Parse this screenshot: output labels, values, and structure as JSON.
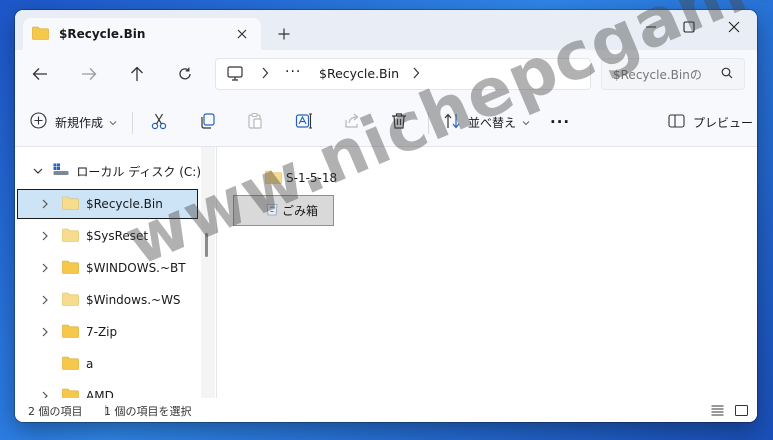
{
  "tab": {
    "title": "$Recycle.Bin",
    "close_icon": "close-icon",
    "new_tab_icon": "plus-icon"
  },
  "window_controls": {
    "minimize_icon": "minimize-icon",
    "maximize_icon": "maximize-icon",
    "close_icon": "close-icon"
  },
  "nav": {
    "back_icon": "arrow-left-icon",
    "forward_icon": "arrow-right-icon",
    "up_icon": "arrow-up-icon",
    "refresh_icon": "refresh-icon",
    "address": {
      "pc_icon": "monitor-icon",
      "more": "···",
      "crumb": "$Recycle.Bin"
    },
    "search": {
      "placeholder": "$Recycle.Binの",
      "icon": "search-icon"
    }
  },
  "commands": {
    "new_label": "新規作成",
    "sort_label": "並べ替え",
    "more_label": "···",
    "preview_label": "プレビュー"
  },
  "sidebar": {
    "drive": "ローカル ディスク (C:)",
    "items": [
      {
        "label": "$Recycle.Bin",
        "selected": true,
        "expandable": true
      },
      {
        "label": "$SysReset",
        "expandable": true
      },
      {
        "label": "$WINDOWS.~BT",
        "expandable": true
      },
      {
        "label": "$Windows.~WS",
        "expandable": true
      },
      {
        "label": "7-Zip",
        "expandable": true
      },
      {
        "label": "a",
        "expandable": false
      },
      {
        "label": "AMD",
        "expandable": true
      }
    ]
  },
  "content": {
    "items": [
      {
        "label": "S-1-5-18",
        "icon": "folder-icon",
        "selected": false
      },
      {
        "label": "ごみ箱",
        "icon": "recycle-bin-icon",
        "selected": true
      }
    ]
  },
  "status": {
    "count": "2 個の項目",
    "selection": "1 個の項目を選択",
    "details_view_icon": "details-view-icon",
    "tiles_view_icon": "large-icons-view-icon"
  },
  "watermark": "www.nichepcgamer.com",
  "colors": {
    "desktop": "#2f86e8",
    "selection": "#cde3f6",
    "folder": "#f6c84a"
  }
}
